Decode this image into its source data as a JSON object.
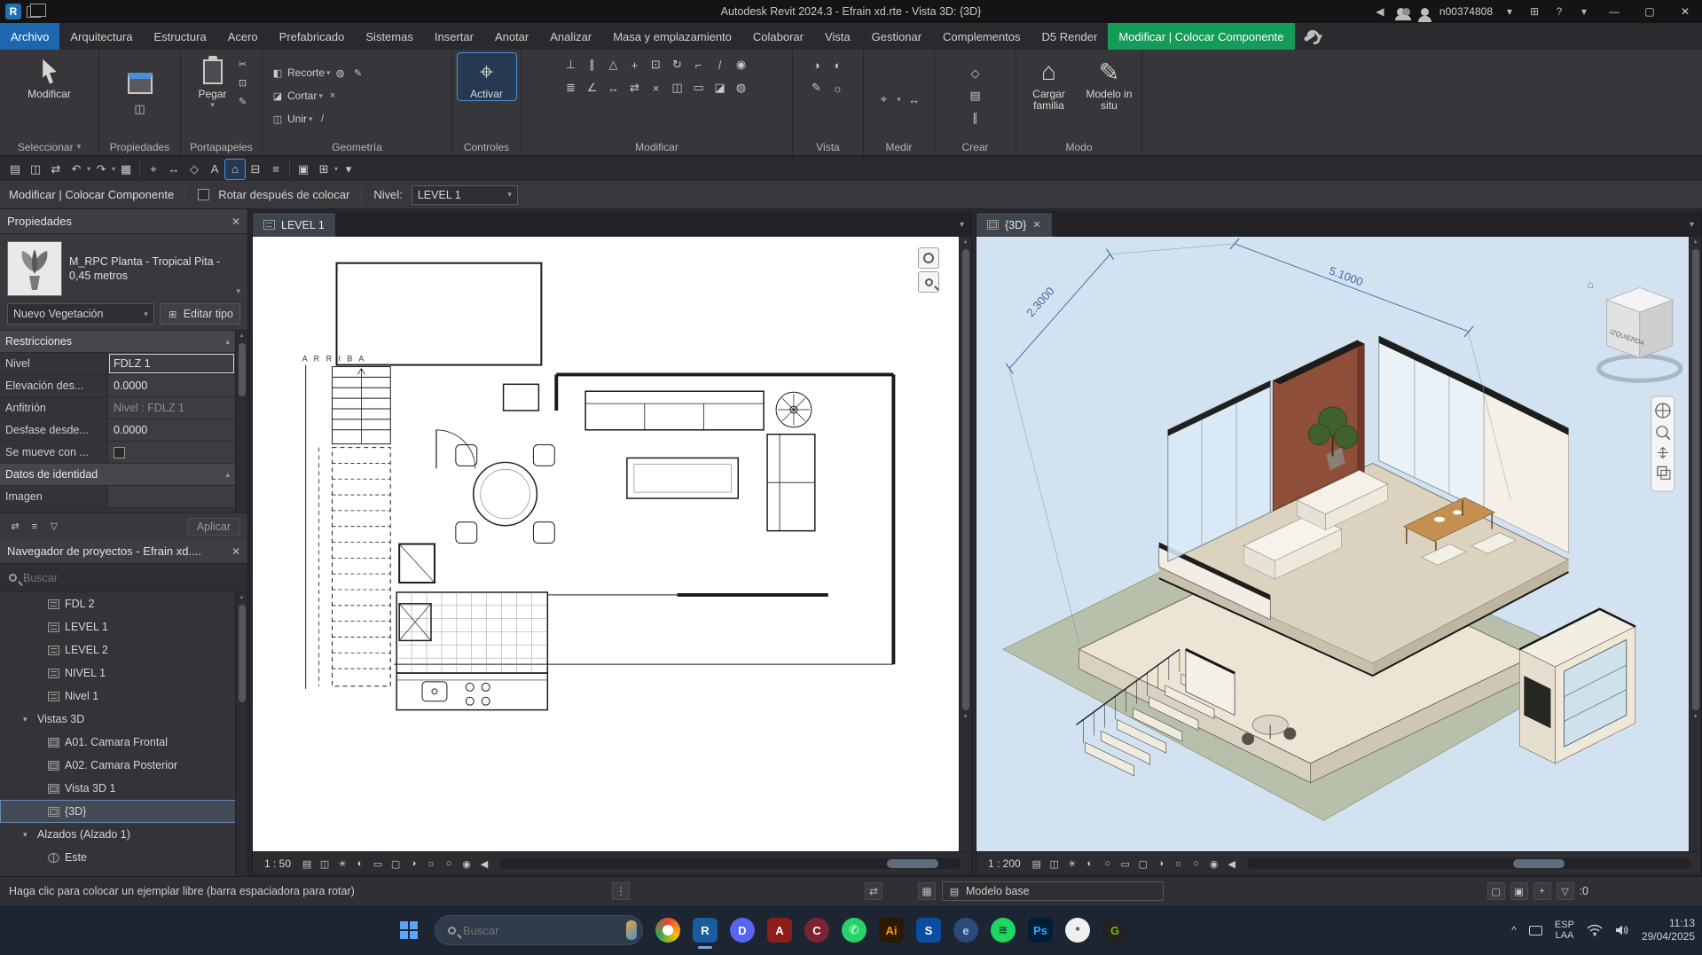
{
  "glyphs": {
    "caret": "▾",
    "caret_up": "▴",
    "tri_left": "◀",
    "up": "▲",
    "down": "▼",
    "close": "✕",
    "minimize": "—",
    "maximize": "▢",
    "help": "?",
    "chev_up": "^",
    "open": "▤",
    "save": "◫",
    "sync": "⇄",
    "undo": "↶",
    "redo": "↷",
    "print": "▦",
    "measure": "⌖",
    "dimension": "↔",
    "tag": "◇",
    "text": "A",
    "home3d": "⌂",
    "section": "⊟",
    "thin_lines": "≡",
    "switch_windows": "⊞",
    "close_windows": "▣",
    "cut": "✂",
    "copy": "⊡",
    "brush": "✎",
    "cope": "◧",
    "geo_cut": "◪",
    "bucket": "◍",
    "align": "⊥",
    "offset": "∥",
    "mirror": "△",
    "move": "+",
    "rotate": "↻",
    "trim": "⌐",
    "split": "/",
    "array": "≣",
    "scale": "∠",
    "pin": "◉",
    "delete": "×",
    "sun": "☀",
    "sh": "◐",
    "crop": "▭",
    "hide": "◑",
    "reveal": "☼",
    "filter": "▽",
    "grip": "⋮",
    "workset": "▦",
    "detail": "▤",
    "vstyle": "◫",
    "star": "○"
  },
  "title_bar": {
    "app_title": "Autodesk Revit 2024.3 - Efrain xd.rte - Vista 3D: {3D}",
    "user": "n00374808"
  },
  "ribbon": {
    "tabs": [
      "Archivo",
      "Arquitectura",
      "Estructura",
      "Acero",
      "Prefabricado",
      "Sistemas",
      "Insertar",
      "Anotar",
      "Analizar",
      "Masa y emplazamiento",
      "Colaborar",
      "Vista",
      "Gestionar",
      "Complementos",
      "D5 Render",
      "Modificar | Colocar Componente"
    ],
    "panels": {
      "seleccionar": {
        "label": "Seleccionar",
        "modify": "Modificar"
      },
      "propiedades": {
        "label": "Propiedades"
      },
      "portapapeles": {
        "label": "Portapapeles",
        "paste": "Pegar"
      },
      "geometria": {
        "label": "Geometría",
        "row1": "Recorte",
        "row2": "Cortar",
        "row3": "Unir"
      },
      "controles": {
        "label": "Controles",
        "activate": "Activar"
      },
      "modificar": {
        "label": "Modificar"
      },
      "vista": {
        "label": "Vista"
      },
      "medir": {
        "label": "Medir"
      },
      "crear": {
        "label": "Crear"
      },
      "modo": {
        "label": "Modo",
        "load_family": "Cargar familia",
        "in_situ": "Modelo in situ"
      }
    }
  },
  "options_bar": {
    "mode": "Modificar | Colocar Componente",
    "rotate_checkbox": "Rotar después de colocar",
    "level_label": "Nivel:",
    "level_value": "LEVEL 1"
  },
  "properties_panel": {
    "title": "Propiedades",
    "type_name": "M_RPC Planta - Tropical Pita - 0,45 metros",
    "family_combo": "Nuevo Vegetación",
    "edit_type": "Editar tipo",
    "rows": [
      {
        "label": "Restricciones",
        "value": ""
      },
      {
        "label": "Nivel",
        "value": "FDLZ 1"
      },
      {
        "label": "Elevación des...",
        "value": "0.0000"
      },
      {
        "label": "Anfitrión",
        "value": "Nivel : FDLZ 1"
      },
      {
        "label": "Desfase desde...",
        "value": "0.0000"
      },
      {
        "label": "Se mueve con ...",
        "value": ""
      },
      {
        "label": "Datos de identidad",
        "value": ""
      },
      {
        "label": "Imagen",
        "value": ""
      }
    ],
    "apply": "Aplicar"
  },
  "project_browser": {
    "title": "Navegador de proyectos - Efrain xd....",
    "search_placeholder": "Buscar",
    "items": [
      {
        "label": "FDL 2"
      },
      {
        "label": "LEVEL 1"
      },
      {
        "label": "LEVEL 2"
      },
      {
        "label": "NIVEL 1"
      },
      {
        "label": "Nivel 1"
      },
      {
        "label": "Vistas 3D"
      },
      {
        "label": "A01. Camara Frontal"
      },
      {
        "label": "A02. Camara Posterior"
      },
      {
        "label": "Vista 3D 1"
      },
      {
        "label": "{3D}"
      },
      {
        "label": "Alzados (Alzado 1)"
      },
      {
        "label": "Este"
      }
    ]
  },
  "plan_view": {
    "tab": "LEVEL 1",
    "scale": "1 : 50",
    "arriba": "A R R I B A"
  },
  "view_3d": {
    "tab": "{3D}",
    "scale": "1 : 200",
    "dim1": "2.3000",
    "dim2": "5.1000",
    "viewcube_face": "IZQUIERDA"
  },
  "status_bar": {
    "message": "Haga clic para colocar un ejemplar libre (barra espaciadora para rotar)",
    "workset_value": "Modelo base",
    "selection_count": ":0"
  },
  "taskbar": {
    "search_placeholder": "Buscar",
    "language": "ESP",
    "language_sub": "LAA",
    "time": "11:13",
    "date": "29/04/2025"
  }
}
